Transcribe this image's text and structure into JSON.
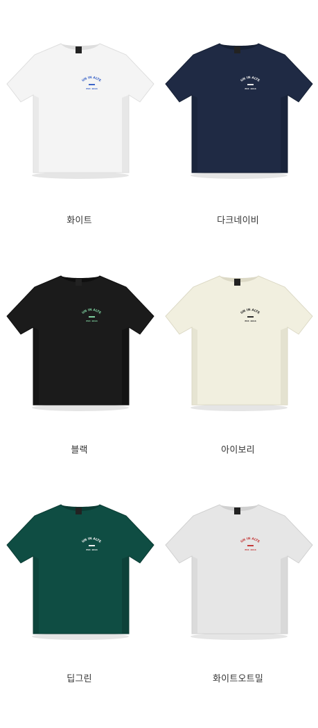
{
  "products": [
    {
      "color_name": "화이트",
      "body": "#f4f4f4",
      "shade": "#dedede",
      "print": "#3b64c8",
      "print_text": "RUN IN ALTER",
      "print_sub": "EST. 2016"
    },
    {
      "color_name": "다크네이비",
      "body": "#1f2a44",
      "shade": "#162034",
      "print": "#e9e9e9",
      "print_text": "RUN IN ALTER",
      "print_sub": "EST. 2016"
    },
    {
      "color_name": "블랙",
      "body": "#1b1b1b",
      "shade": "#0f0f0f",
      "print": "#7fd1a0",
      "print_text": "RUN IN ALTER",
      "print_sub": "EST. 2016"
    },
    {
      "color_name": "아이보리",
      "body": "#f1efdf",
      "shade": "#dcd9c6",
      "print": "#2e2e2e",
      "print_text": "RUN IN ALTER",
      "print_sub": "EST. 2016"
    },
    {
      "color_name": "딥그린",
      "body": "#0f4d43",
      "shade": "#0b3b33",
      "print": "#f2f2f2",
      "print_text": "RUN IN ALTER",
      "print_sub": "EST. 2016"
    },
    {
      "color_name": "화이트오트밀",
      "body": "#e6e6e6",
      "shade": "#d0d0d0",
      "print": "#c43a3a",
      "print_text": "RUN IN ALTER",
      "print_sub": "EST. 2016"
    }
  ]
}
